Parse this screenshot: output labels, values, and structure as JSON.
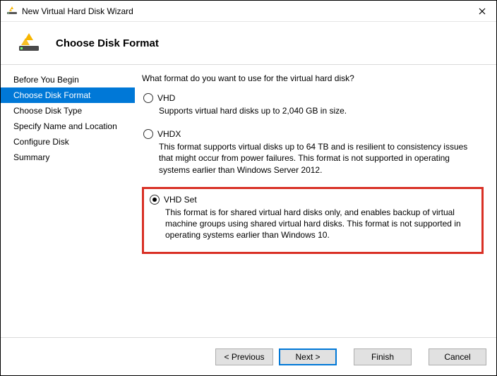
{
  "window": {
    "title": "New Virtual Hard Disk Wizard"
  },
  "header": {
    "title": "Choose Disk Format"
  },
  "sidebar": {
    "steps": [
      {
        "label": "Before You Begin"
      },
      {
        "label": "Choose Disk Format"
      },
      {
        "label": "Choose Disk Type"
      },
      {
        "label": "Specify Name and Location"
      },
      {
        "label": "Configure Disk"
      },
      {
        "label": "Summary"
      }
    ],
    "active_index": 1
  },
  "content": {
    "prompt": "What format do you want to use for the virtual hard disk?",
    "options": [
      {
        "label": "VHD",
        "desc": "Supports virtual hard disks up to 2,040 GB in size.",
        "selected": false
      },
      {
        "label": "VHDX",
        "desc": "This format supports virtual disks up to 64 TB and is resilient to consistency issues that might occur from power failures. This format is not supported in operating systems earlier than Windows Server 2012.",
        "selected": false
      },
      {
        "label": "VHD Set",
        "desc": "This format is for shared virtual hard disks only, and enables backup of virtual machine groups using shared virtual hard disks. This format is not supported in operating systems earlier than Windows 10.",
        "selected": true,
        "highlighted": true
      }
    ]
  },
  "footer": {
    "previous": "< Previous",
    "next": "Next >",
    "finish": "Finish",
    "cancel": "Cancel"
  }
}
